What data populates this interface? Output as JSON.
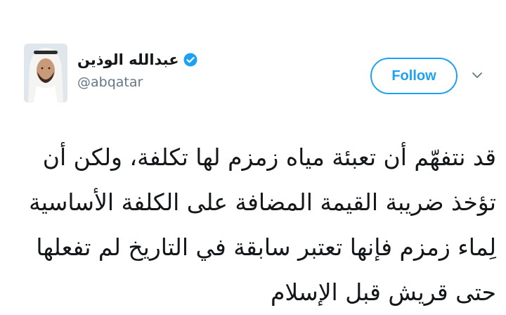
{
  "tweet": {
    "author": {
      "display_name": "عبدالله الوذين",
      "handle": "@abqatar",
      "verified": true
    },
    "follow_label": "Follow",
    "text": "قد نتفهّم أن تعبئة مياه زمزم لها تكلفة، ولكن أن تؤخذ ضريبة القيمة المضافة على الكلفة الأساسية لِماء زمزم فإنها تعتبر سابقة في التاريخ لم تفعلها حتى قريش قبل الإسلام"
  },
  "colors": {
    "accent": "#1da1f2",
    "text": "#14171a",
    "secondary_text": "#657786",
    "background": "#ffffff"
  },
  "icons": {
    "verified": "verified-badge-icon",
    "menu": "chevron-down-icon"
  }
}
